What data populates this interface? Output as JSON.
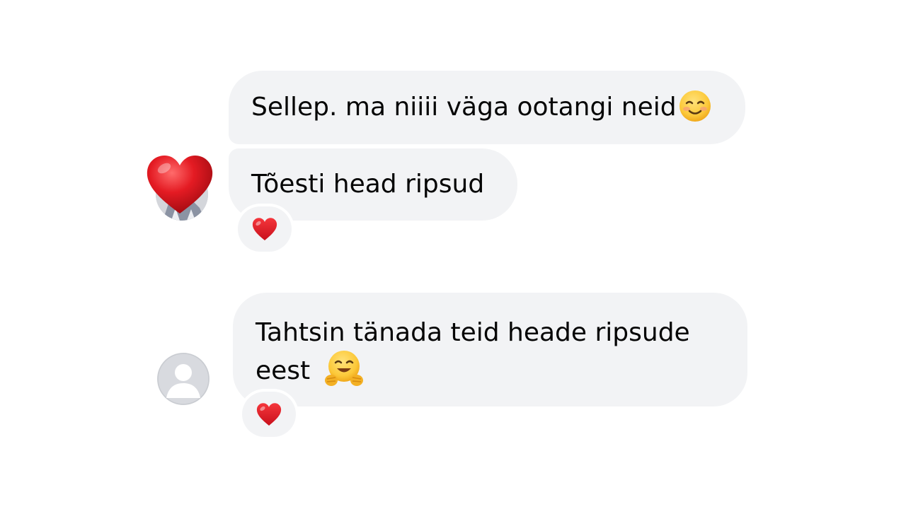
{
  "conversation": {
    "group1": {
      "message1": {
        "text": "Sellep. ma niiii väga ootangi neid",
        "emoji": "smiling-face-icon"
      },
      "message2": {
        "text": "Tõesti head ripsud",
        "reaction": "red-heart-icon"
      },
      "avatar": "heart-avatar-icon"
    },
    "group2": {
      "message1": {
        "line1": "Tahtsin tänada teid heade ripsude",
        "line2": "eest",
        "emoji": "hugging-face-icon",
        "reaction": "red-heart-icon"
      },
      "avatar": "default-profile-icon"
    }
  },
  "colors": {
    "bubble": "#f2f3f5",
    "text": "#050505",
    "heart": "#e0162b",
    "avatar_bg": "#d8dadf"
  }
}
